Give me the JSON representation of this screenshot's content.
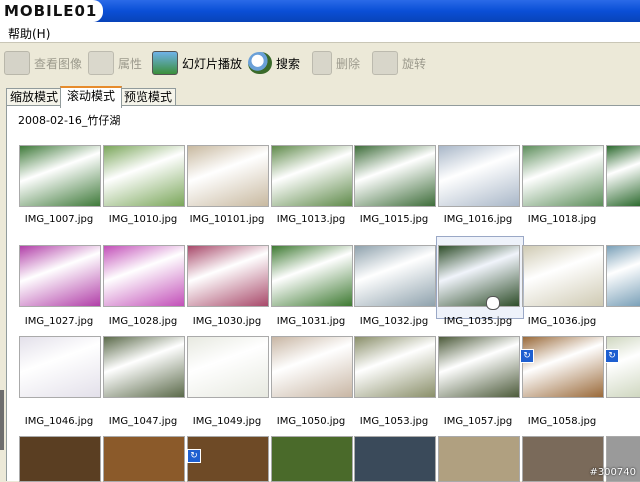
{
  "logo": {
    "text": "MOBILE01"
  },
  "menu": {
    "help": "帮助(H)"
  },
  "toolbar": {
    "view_image": "查看图像",
    "properties": "属性",
    "slideshow": "幻灯片播放",
    "search": "搜索",
    "delete": "删除",
    "rotate": "旋转"
  },
  "tabs": [
    {
      "label": "缩放模式"
    },
    {
      "label": "滚动模式"
    },
    {
      "label": "预览模式"
    }
  ],
  "folder": "2008-02-16_竹仔湖",
  "rows": [
    {
      "files": [
        "IMG_1007.jpg",
        "IMG_1010.jpg",
        "IMG_10101.jpg",
        "IMG_1013.jpg",
        "IMG_1015.jpg",
        "IMG_1016.jpg",
        "IMG_1018.jpg"
      ]
    },
    {
      "files": [
        "IMG_1027.jpg",
        "IMG_1028.jpg",
        "IMG_1030.jpg",
        "IMG_1031.jpg",
        "IMG_1032.jpg",
        "IMG_1035.jpg",
        "IMG_1036.jpg"
      ]
    },
    {
      "files": [
        "IMG_1046.jpg",
        "IMG_1047.jpg",
        "IMG_1049.jpg",
        "IMG_1050.jpg",
        "IMG_1053.jpg",
        "IMG_1057.jpg",
        "IMG_1058.jpg"
      ]
    }
  ],
  "watermark": "#300740",
  "colors": {
    "title_bar": "#0a4fd6",
    "tab_accent": "#e68b2c",
    "badge": "#1e5fd0"
  }
}
